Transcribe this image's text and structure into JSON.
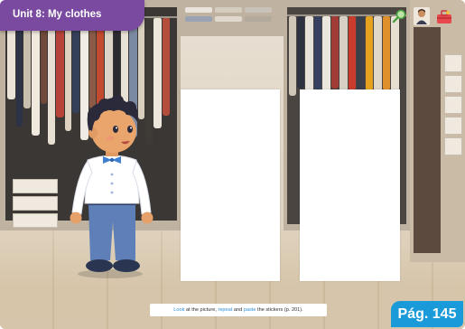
{
  "header": {
    "unit_title": "Unit 8: My clothes",
    "bar_color": "#7a4aa0"
  },
  "toolbar": {
    "icons": [
      "magnifier-icon",
      "teacher-avatar-icon",
      "toolbox-icon"
    ]
  },
  "instruction": {
    "parts": [
      {
        "text": "Look",
        "highlight": true
      },
      {
        "text": " at the picture, ",
        "highlight": false
      },
      {
        "text": "repeat",
        "highlight": true
      },
      {
        "text": " and ",
        "highlight": false
      },
      {
        "text": "paste",
        "highlight": true
      },
      {
        "text": " the stickers (p. 201).",
        "highlight": false
      }
    ],
    "highlight_color": "#2f8fd6"
  },
  "page_badge": {
    "label": "Pág. 145",
    "color": "#1a9ad8"
  }
}
